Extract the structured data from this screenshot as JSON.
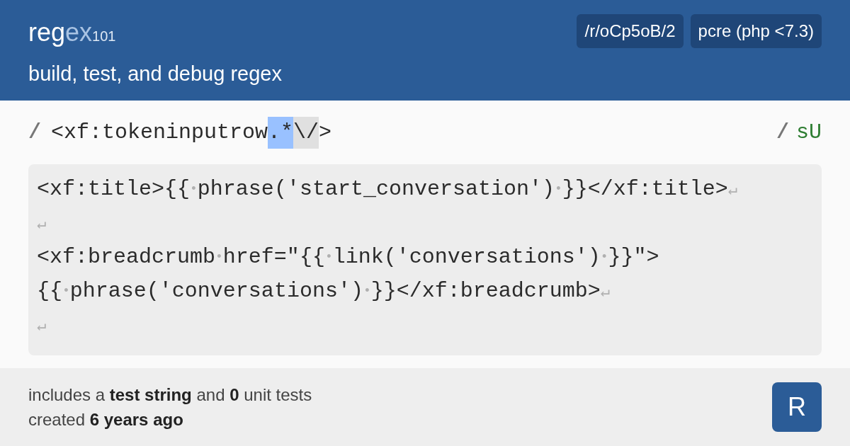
{
  "header": {
    "logo": {
      "main": "reg",
      "faded": "ex",
      "sub": "101"
    },
    "tagline": "build, test, and debug regex",
    "badges": [
      "/r/oCp5oB/2",
      "pcre (php <7.3)"
    ]
  },
  "regex": {
    "open_delimiter": "/",
    "tokens": [
      {
        "kind": "text",
        "text": "<xf:tokeninputrow"
      },
      {
        "kind": "match",
        "text": ".*"
      },
      {
        "kind": "escape",
        "text": "\\/"
      },
      {
        "kind": "text",
        "text": ">"
      }
    ],
    "close_delimiter": "/",
    "flags": "sU"
  },
  "test_string": {
    "lines": [
      [
        {
          "kind": "text",
          "text": "<xf:title>{{"
        },
        {
          "kind": "space",
          "text": "•"
        },
        {
          "kind": "text",
          "text": "phrase('start_conversation')"
        },
        {
          "kind": "space",
          "text": "•"
        },
        {
          "kind": "text",
          "text": "}}</xf:title>"
        },
        {
          "kind": "newline",
          "text": "↵"
        }
      ],
      [
        {
          "kind": "newline",
          "text": "↵"
        }
      ],
      [
        {
          "kind": "text",
          "text": "<xf:breadcrumb"
        },
        {
          "kind": "space",
          "text": "•"
        },
        {
          "kind": "text",
          "text": "href=\"{{"
        },
        {
          "kind": "space",
          "text": "•"
        },
        {
          "kind": "text",
          "text": "link('conversations')"
        },
        {
          "kind": "space",
          "text": "•"
        },
        {
          "kind": "text",
          "text": "}}\">"
        }
      ],
      [
        {
          "kind": "text",
          "text": "{{"
        },
        {
          "kind": "space",
          "text": "•"
        },
        {
          "kind": "text",
          "text": "phrase('conversations')"
        },
        {
          "kind": "space",
          "text": "•"
        },
        {
          "kind": "text",
          "text": "}}</xf:breadcrumb>"
        },
        {
          "kind": "newline",
          "text": "↵"
        }
      ],
      [
        {
          "kind": "newline",
          "text": "↵"
        }
      ]
    ]
  },
  "footer": {
    "lines": [
      "includes a **test string** and **0** unit tests",
      "created **6 years ago**"
    ],
    "avatar": "R"
  }
}
